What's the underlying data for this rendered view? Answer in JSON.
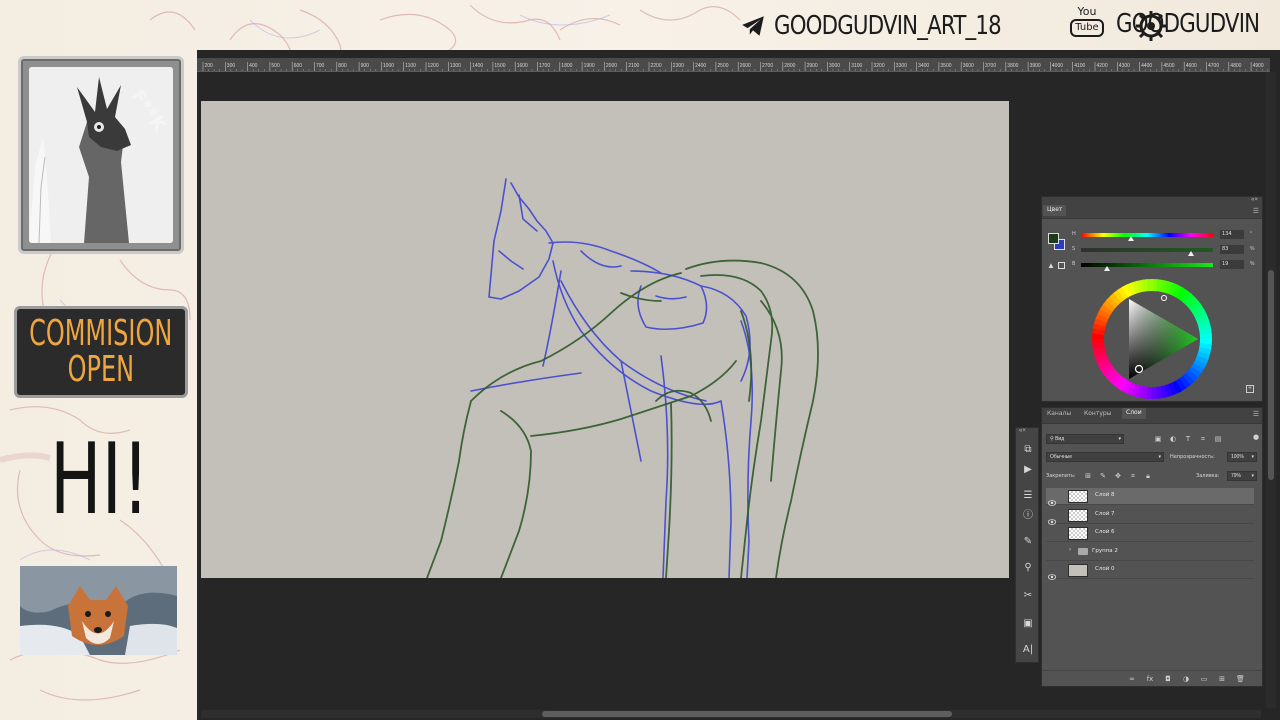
{
  "banner": {
    "telegram_handle": "GOODGUDVIN_ART_18",
    "youtube_badge": "You Tube",
    "youtube_handle": "GOODGUDVIN"
  },
  "avatar": {
    "caption": "F**K"
  },
  "commission": {
    "line1": "COMMISION",
    "line2": "OPEN"
  },
  "greeting": "HI!",
  "ruler": {
    "labels": [
      "200",
      "300",
      "400",
      "500",
      "600",
      "700",
      "800",
      "900",
      "1000",
      "1100",
      "1200",
      "1300",
      "1400",
      "1500",
      "1600",
      "1700",
      "1800",
      "1900",
      "2000",
      "2100",
      "2200",
      "2300",
      "2400",
      "2500",
      "2600",
      "2700",
      "2800",
      "2900",
      "3000",
      "3100",
      "3200",
      "3300",
      "3400",
      "3500",
      "3600",
      "3700",
      "3800",
      "3900",
      "4000",
      "4100",
      "4200",
      "4300",
      "4400",
      "4500",
      "4600",
      "4700",
      "4800",
      "4900"
    ]
  },
  "color_panel": {
    "tab": "Цвет",
    "sliders": [
      {
        "letter": "H",
        "value": "134",
        "unit": "°",
        "position": 0.37
      },
      {
        "letter": "S",
        "value": "83",
        "unit": "%",
        "position": 0.83
      },
      {
        "letter": "B",
        "value": "19",
        "unit": "%",
        "position": 0.19
      }
    ],
    "foreground": "#1d3b1a",
    "background": "#2f3bbf"
  },
  "layers_panel": {
    "tabs": [
      "Каналы",
      "Контуры",
      "Слои"
    ],
    "active_tab": "Слои",
    "filter_label": "Вид",
    "blend_mode": "Обычные",
    "opacity_label": "Непрозрачность:",
    "opacity_value": "100%",
    "lock_label": "Закрепить:",
    "fill_label": "Заливка:",
    "fill_value": "79%",
    "layers": [
      {
        "name": "Слой 8",
        "visible": true,
        "selected": true,
        "type": "layer"
      },
      {
        "name": "Слой 7",
        "visible": true,
        "selected": false,
        "type": "layer"
      },
      {
        "name": "Слой 6",
        "visible": false,
        "selected": false,
        "type": "layer"
      },
      {
        "name": "Группа 2",
        "visible": false,
        "selected": false,
        "type": "group"
      },
      {
        "name": "Слой 0",
        "visible": true,
        "selected": false,
        "type": "solid"
      }
    ]
  },
  "colors": {
    "accent_orange": "#f0a640",
    "sketch_blue": "#3f45d1",
    "sketch_green": "#2f5a2a",
    "canvas_bg": "#c3c0ba"
  },
  "icons": [
    "telegram-icon",
    "gear-icon",
    "youtube-icon",
    "eye-icon",
    "lock-icon",
    "trash-icon",
    "folder-icon",
    "link-icon",
    "fx-icon",
    "mask-icon",
    "adjustment-icon",
    "new-layer-icon"
  ]
}
